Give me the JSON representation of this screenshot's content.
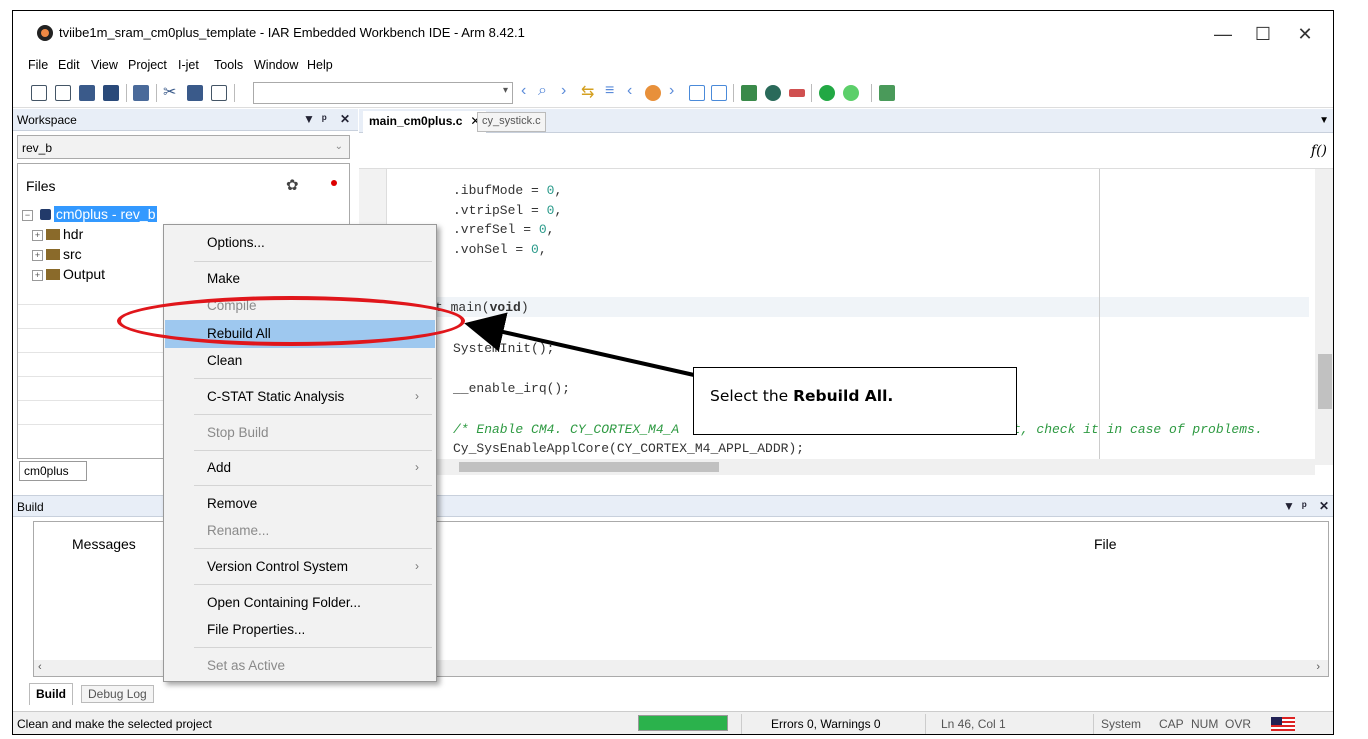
{
  "window": {
    "title": "tviibe1m_sram_cm0plus_template - IAR Embedded Workbench IDE - Arm 8.42.1",
    "minimize": "—",
    "maximize": "☐",
    "close": "✕"
  },
  "menu": [
    "File",
    "Edit",
    "View",
    "Project",
    "I-jet",
    "Tools",
    "Window",
    "Help"
  ],
  "workspace": {
    "title": "Workspace",
    "controls": [
      "▼",
      "ᵖ",
      "✕"
    ],
    "config": "rev_b",
    "tree_header": "Files",
    "items": [
      {
        "label": "cm0plus - rev_b"
      },
      {
        "label": "hdr"
      },
      {
        "label": "src"
      },
      {
        "label": "Output"
      }
    ],
    "tab": "cm0plus"
  },
  "editor": {
    "tabs": [
      {
        "label": "main_cm0plus.c",
        "close": "✕"
      },
      {
        "label": "cy_systick.c"
      }
    ],
    "fn_icon": "f()",
    "lines": [
      {
        "prefix": ".ibufMode = ",
        "num": "0",
        "suffix": ","
      },
      {
        "prefix": ".vtripSel = ",
        "num": "0",
        "suffix": ","
      },
      {
        "prefix": ".vrefSel = ",
        "num": "0",
        "suffix": ","
      },
      {
        "prefix": ".vohSel = ",
        "num": "0",
        "suffix": ","
      }
    ],
    "main_sig_pre": "t main(",
    "main_sig_kw": "void",
    "main_sig_post": ")",
    "system_init": "SystemInit();",
    "enable_irq": "__enable_irq();",
    "comment_start": "/* Enable CM4. CY_CORTEX_M4_A",
    "comment_end": "t, check it in case of problems.",
    "enable_core": "Cy_SysEnableApplCore(CY_CORTEX_M4_APPL_ADDR);"
  },
  "build": {
    "title": "Build",
    "columns": {
      "messages": "Messages",
      "file": "File"
    },
    "tabs": [
      "Build",
      "Debug Log"
    ]
  },
  "status": {
    "message": "Clean and make the selected project",
    "progress": 1.0,
    "errors": "Errors 0, Warnings 0",
    "position": "Ln 46, Col 1",
    "system": "System",
    "cap": "CAP",
    "num": "NUM",
    "ovr": "OVR"
  },
  "context_menu": {
    "items": [
      {
        "label": "Options...",
        "disabled": false
      },
      {
        "label": "Make",
        "disabled": false
      },
      {
        "label": "Compile",
        "disabled": true
      },
      {
        "label": "Rebuild All",
        "disabled": false,
        "highlighted": true
      },
      {
        "label": "Clean",
        "disabled": false
      },
      {
        "label": "C-STAT Static Analysis",
        "disabled": false,
        "submenu": true
      },
      {
        "label": "Stop Build",
        "disabled": true
      },
      {
        "label": "Add",
        "disabled": false,
        "submenu": true
      },
      {
        "label": "Remove",
        "disabled": false
      },
      {
        "label": "Rename...",
        "disabled": true
      },
      {
        "label": "Version Control System",
        "disabled": false,
        "submenu": true
      },
      {
        "label": "Open Containing Folder...",
        "disabled": false
      },
      {
        "label": "File Properties...",
        "disabled": false
      },
      {
        "label": "Set as Active",
        "disabled": true
      }
    ],
    "submenu_arrow": "›"
  },
  "annotation": {
    "callout_prefix": "Select the ",
    "callout_bold": "Rebuild All.",
    "highlight_color": "#e0161b"
  }
}
